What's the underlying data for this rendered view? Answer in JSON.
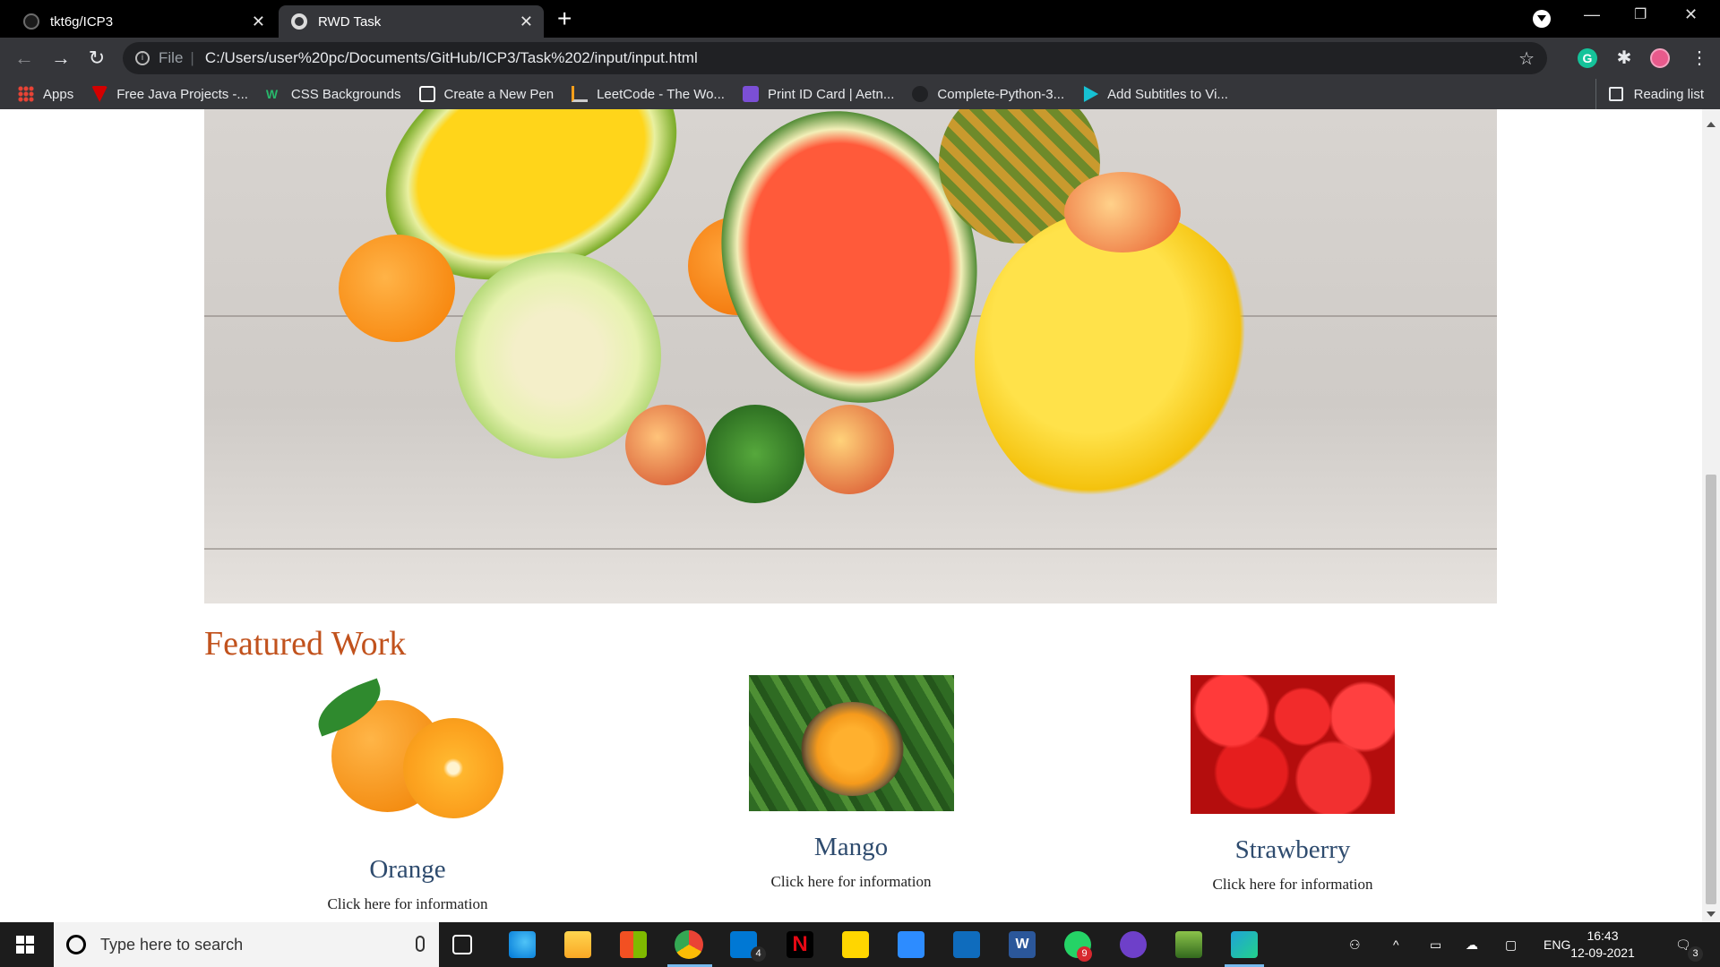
{
  "browser": {
    "tabs": [
      {
        "title": "tkt6g/ICP3"
      },
      {
        "title": "RWD Task"
      }
    ],
    "address": {
      "protocol_label": "File",
      "url": "C:/Users/user%20pc/Documents/GitHub/ICP3/Task%202/input/input.html"
    },
    "bookmarks": [
      {
        "label": "Apps",
        "icon": "apps-grid-icon",
        "color": "#ea4335"
      },
      {
        "label": "Free Java Projects -...",
        "icon": "red-shield-icon",
        "color": "#d40000"
      },
      {
        "label": "CSS Backgrounds",
        "icon": "w-logo-icon",
        "color": "#28b76b"
      },
      {
        "label": "Create a New Pen",
        "icon": "codepen-icon",
        "color": "#ffffff"
      },
      {
        "label": "LeetCode - The Wo...",
        "icon": "leetcode-icon",
        "color": "#f89f1b"
      },
      {
        "label": "Print ID Card | Aetn...",
        "icon": "aetn-icon",
        "color": "#7b4fd6"
      },
      {
        "label": "Complete-Python-3...",
        "icon": "github-icon",
        "color": "#202124"
      },
      {
        "label": "Add Subtitles to Vi...",
        "icon": "play-icon",
        "color": "#16c1d3"
      }
    ],
    "reading_list": "Reading list"
  },
  "page": {
    "section_title": "Featured Work",
    "cards": [
      {
        "name": "Orange",
        "link": "Click here for information"
      },
      {
        "name": "Mango",
        "link": "Click here for information"
      },
      {
        "name": "Strawberry",
        "link": "Click here for information"
      }
    ]
  },
  "taskbar": {
    "search_placeholder": "Type here to search",
    "mail_badge": "4",
    "whatsapp_badge": "9",
    "language": "ENG",
    "time": "16:43",
    "date": "12-09-2021",
    "notifications": "3"
  }
}
